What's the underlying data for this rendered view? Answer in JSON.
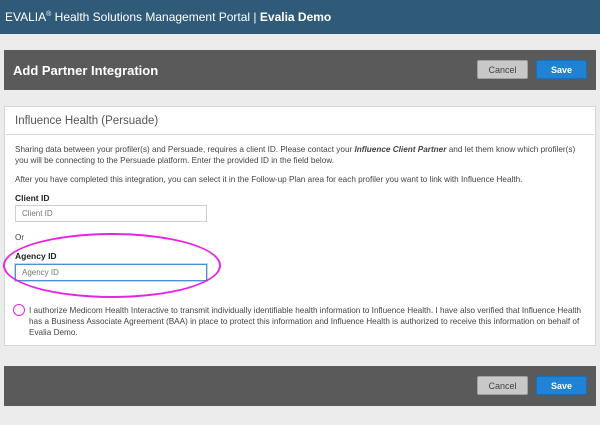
{
  "topbar": {
    "brand": "EVALIA",
    "trademark": "®",
    "portal": " Health Solutions Management Portal | ",
    "org": "Evalia Demo"
  },
  "header": {
    "title": "Add Partner Integration",
    "cancel_label": "Cancel",
    "save_label": "Save"
  },
  "card": {
    "title": "Influence Health (Persuade)",
    "intro_before": "Sharing data between your profiler(s) and Persuade, requires a client ID. Please contact your ",
    "intro_emphasis": "Influence Client Partner",
    "intro_after": " and let them know which profiler(s) you will be connecting to the Persuade platform. Enter the provided ID in the field below.",
    "followup_note": "After you have completed this integration, you can select it in the Follow-up Plan area for each profiler you want to link with Influence Health.",
    "client_id_label": "Client ID",
    "client_id_placeholder": "Client ID",
    "client_id_value": "",
    "or_text": "Or",
    "agency_id_label": "Agency ID",
    "agency_id_placeholder": "Agency ID",
    "agency_id_value": "",
    "authorization_text": "I authorize Medicom Health Interactive to transmit individually identifiable health information to Influence Health. I have also verified that Influence Health has a Business Associate Agreement (BAA) in place to protect this information and Influence Health is authorized to receive this information on behalf of Evalia Demo.",
    "authorization_checked": false
  },
  "footer": {
    "cancel_label": "Cancel",
    "save_label": "Save"
  },
  "colors": {
    "topbar": "#2f5a78",
    "header_bar": "#5a5a5a",
    "save_button": "#1f82d4",
    "annotation": "#e624e6"
  }
}
